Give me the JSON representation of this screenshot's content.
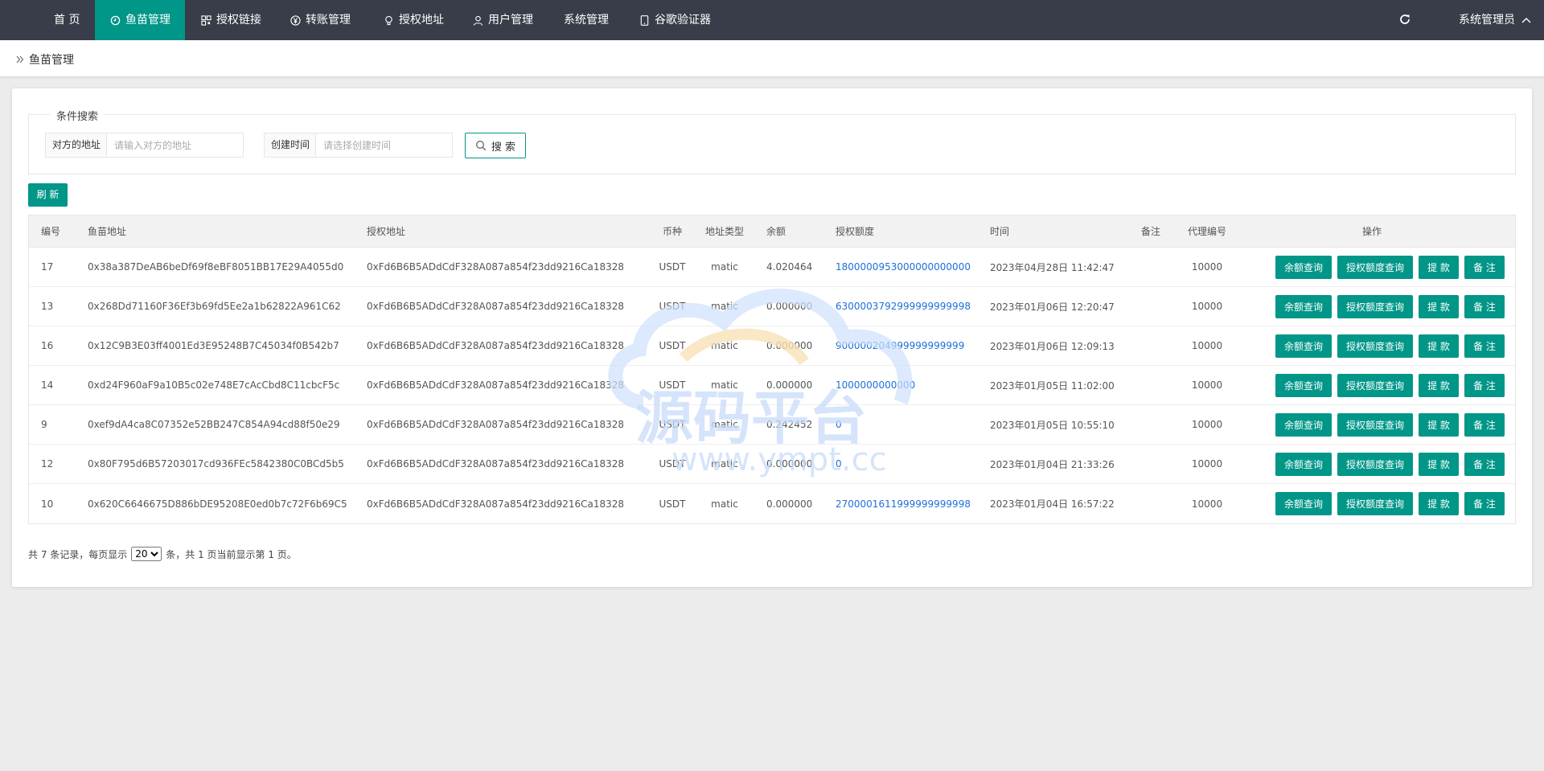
{
  "nav": {
    "items": [
      {
        "label": "首 页",
        "icon": "",
        "active": false
      },
      {
        "label": "鱼苗管理",
        "icon": "clock-icon",
        "active": true
      },
      {
        "label": "授权链接",
        "icon": "qrcode-icon",
        "active": false
      },
      {
        "label": "转账管理",
        "icon": "yen-icon",
        "active": false
      },
      {
        "label": "授权地址",
        "icon": "bulb-icon",
        "active": false
      },
      {
        "label": "用户管理",
        "icon": "user-icon",
        "active": false
      },
      {
        "label": "系统管理",
        "icon": "",
        "active": false
      },
      {
        "label": "谷歌验证器",
        "icon": "tablet-icon",
        "active": false
      }
    ],
    "user": "系统管理员",
    "accent": "#009688",
    "bar_color": "#393d49"
  },
  "breadcrumb": "鱼苗管理",
  "search": {
    "legend": "条件搜索",
    "address_label": "对方的地址",
    "address_placeholder": "请输入对方的地址",
    "time_label": "创建时间",
    "time_placeholder": "请选择创建时间",
    "search_label": "搜 索"
  },
  "refresh_label": "刷 新",
  "table": {
    "headers": [
      "编号",
      "鱼苗地址",
      "授权地址",
      "币种",
      "地址类型",
      "余额",
      "授权额度",
      "时间",
      "备注",
      "代理编号",
      "操作"
    ],
    "rows": [
      {
        "id": "17",
        "fish": "0x38a387DeAB6beDf69f8eBF8051BB17E29A4055d0",
        "auth": "0xFd6B6B5ADdCdF328A087a854f23dd9216Ca18328",
        "coin": "USDT",
        "type": "matic",
        "balance": "4.020464",
        "quota": "1800000953000000000000",
        "time": "2023年04月28日 11:42:47",
        "note": "",
        "agent": "10000"
      },
      {
        "id": "13",
        "fish": "0x268Dd71160F36Ef3b69fd5Ee2a1b62822A961C62",
        "auth": "0xFd6B6B5ADdCdF328A087a854f23dd9216Ca18328",
        "coin": "USDT",
        "type": "matic",
        "balance": "0.000000",
        "quota": "6300003792999999999998",
        "time": "2023年01月06日 12:20:47",
        "note": "",
        "agent": "10000"
      },
      {
        "id": "16",
        "fish": "0x12C9B3E03ff4001Ed3E95248B7C45034f0B542b7",
        "auth": "0xFd6B6B5ADdCdF328A087a854f23dd9216Ca18328",
        "coin": "USDT",
        "type": "matic",
        "balance": "0.000000",
        "quota": "900000204999999999999",
        "time": "2023年01月06日 12:09:13",
        "note": "",
        "agent": "10000"
      },
      {
        "id": "14",
        "fish": "0xd24F960aF9a10B5c02e748E7cAcCbd8C11cbcF5c",
        "auth": "0xFd6B6B5ADdCdF328A087a854f23dd9216Ca18328",
        "coin": "USDT",
        "type": "matic",
        "balance": "0.000000",
        "quota": "1000000000000",
        "time": "2023年01月05日 11:02:00",
        "note": "",
        "agent": "10000"
      },
      {
        "id": "9",
        "fish": "0xef9dA4ca8C07352e52BB247C854A94cd88f50e29",
        "auth": "0xFd6B6B5ADdCdF328A087a854f23dd9216Ca18328",
        "coin": "USDT",
        "type": "matic",
        "balance": "0.242452",
        "quota": "0",
        "time": "2023年01月05日 10:55:10",
        "note": "",
        "agent": "10000"
      },
      {
        "id": "12",
        "fish": "0x80F795d6B57203017cd936FEc5842380C0BCd5b5",
        "auth": "0xFd6B6B5ADdCdF328A087a854f23dd9216Ca18328",
        "coin": "USDT",
        "type": "matic",
        "balance": "0.000000",
        "quota": "0",
        "time": "2023年01月04日 21:33:26",
        "note": "",
        "agent": "10000"
      },
      {
        "id": "10",
        "fish": "0x620C6646675D886bDE95208E0ed0b7c72F6b69C5",
        "auth": "0xFd6B6B5ADdCdF328A087a854f23dd9216Ca18328",
        "coin": "USDT",
        "type": "matic",
        "balance": "0.000000",
        "quota": "2700001611999999999998",
        "time": "2023年01月04日 16:57:22",
        "note": "",
        "agent": "10000"
      }
    ],
    "actions": [
      "余额查询",
      "授权额度查询",
      "提 款",
      "备 注"
    ]
  },
  "pager": {
    "prefix": "共 7 条记录，每页显示",
    "page_size": "20",
    "suffix": "条，共 1 页当前显示第 1 页。"
  },
  "watermark": {
    "text": "源码平台",
    "url": "www.ympt.cc"
  }
}
